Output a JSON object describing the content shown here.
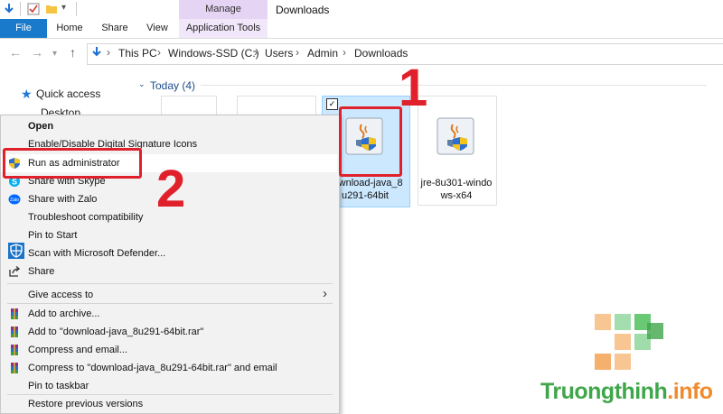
{
  "title_bar": {
    "contextual_group": "Manage",
    "window_title": "Downloads"
  },
  "ribbon": {
    "tabs": [
      "File",
      "Home",
      "Share",
      "View",
      "Application Tools"
    ]
  },
  "address_bar": {
    "breadcrumbs": [
      "This PC",
      "Windows-SSD (C:)",
      "Users",
      "Admin",
      "Downloads"
    ]
  },
  "nav_pane": {
    "quick_access": "Quick access",
    "desktop": "Desktop"
  },
  "content": {
    "group_header": "Today (4)",
    "files": [
      {
        "name_line1": "download-java_8",
        "name_line2": "u291-64bit",
        "selected": true
      },
      {
        "name_line1": "jre-8u301-windo",
        "name_line2": "ws-x64",
        "selected": false
      }
    ]
  },
  "context_menu": {
    "items": [
      {
        "label": "Open",
        "bold": true
      },
      {
        "label": "Enable/Disable Digital Signature Icons"
      },
      {
        "label": "Run as administrator",
        "icon": "uac-shield-icon"
      },
      {
        "label": "Share with Skype",
        "icon": "skype-icon"
      },
      {
        "label": "Share with Zalo",
        "icon": "zalo-icon"
      },
      {
        "label": "Troubleshoot compatibility"
      },
      {
        "label": "Pin to Start"
      },
      {
        "label": "Scan with Microsoft Defender...",
        "icon": "defender-icon"
      },
      {
        "label": "Share",
        "icon": "share-icon"
      },
      {
        "label": "Give access to",
        "submenu": true
      },
      {
        "label": "Add to archive...",
        "icon": "winrar-icon"
      },
      {
        "label": "Add to \"download-java_8u291-64bit.rar\"",
        "icon": "winrar-icon"
      },
      {
        "label": "Compress and email...",
        "icon": "winrar-icon"
      },
      {
        "label": "Compress to \"download-java_8u291-64bit.rar\" and email",
        "icon": "winrar-icon"
      },
      {
        "label": "Pin to taskbar"
      },
      {
        "label": "Restore previous versions"
      }
    ]
  },
  "annotations": {
    "step1": "1",
    "step2": "2",
    "color": "#e0202a"
  },
  "watermark": {
    "text_main": "Truongthinh",
    "text_suffix": ".info"
  }
}
